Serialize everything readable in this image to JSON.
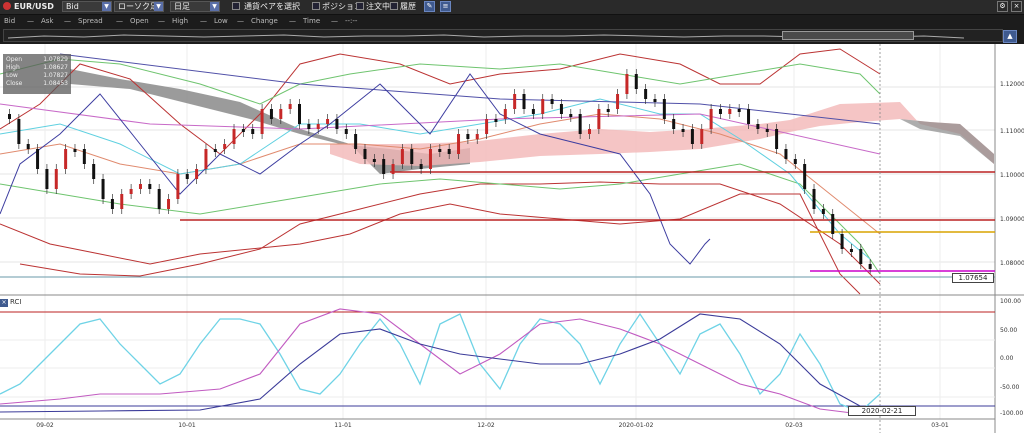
{
  "toolbar": {
    "pair": "EUR/USD",
    "price_type": "Bid",
    "chart_type": "ローソク足",
    "timeframe": "日足",
    "link_pair_label": "通貨ペアを選択",
    "position_label": "ポジション",
    "orders_label": "注文中",
    "history_label": "履歴"
  },
  "legend": {
    "items": [
      "Bid",
      "Ask",
      "Spread",
      "Open",
      "High",
      "Low",
      "Change",
      "Time"
    ],
    "value": "--:--"
  },
  "ohlc": {
    "labels": [
      "Open",
      "High",
      "Low",
      "Close"
    ],
    "values": [
      "1.07829",
      "1.08627",
      "1.07827",
      "1.08453"
    ]
  },
  "price_axis": [
    "1.12000",
    "1.11000",
    "1.10000",
    "1.09000",
    "1.08000"
  ],
  "current_price": "1.07654",
  "rci": {
    "title": "RCI",
    "axis": [
      "100.00",
      "50.00",
      "0.00",
      "-50.00",
      "-100.00"
    ]
  },
  "date_axis": [
    "09-02",
    "10-01",
    "11-01",
    "12-02",
    "2020-01-02",
    "02-03",
    "03-01"
  ],
  "cursor_date": "2020-02-21",
  "colors": {
    "up": "#c62828",
    "down": "#111111",
    "cloud_bull": "#f2b6b6",
    "cloud_bear": "#8a8a8a",
    "bollinger": "#b33",
    "rci_short": "#6fd3e6",
    "rci_mid": "#c15bc1",
    "rci_long": "#3b3b99"
  }
}
